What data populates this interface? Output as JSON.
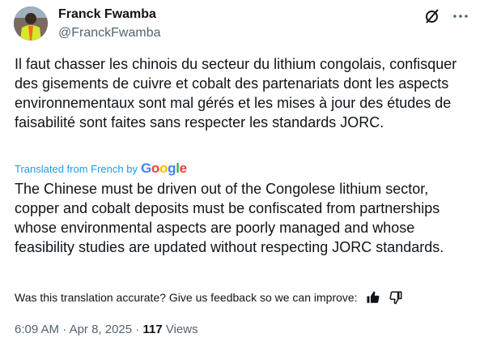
{
  "author": {
    "name": "Franck Fwamba",
    "handle": "@FranckFwamba"
  },
  "tweet": {
    "original_text": "Il faut chasser les chinois du secteur du lithium congolais, confisquer des gisements de cuivre et cobalt des partenariats dont les aspects environnementaux sont mal gérés et les mises à jour des études de faisabilité sont faites sans respecter les standards JORC.",
    "translated_label": "Translated from French by",
    "translator_logo_text": "Google",
    "translated_text": "The Chinese must be driven out of the Congolese lithium sector, copper and cobalt deposits must be confiscated from partnerships whose environmental aspects are poorly managed and whose feasibility studies are updated without respecting JORC standards."
  },
  "feedback": {
    "prompt": "Was this translation accurate? Give us feedback so we can improve:"
  },
  "meta": {
    "time": "6:09 AM",
    "separator": "·",
    "date": "Apr 8, 2025",
    "views_count": "117",
    "views_label": "Views"
  },
  "icons": {
    "grok": "grok-icon",
    "more": "more-icon",
    "thumbs_up": "thumbs-up-icon",
    "thumbs_down": "thumbs-down-icon"
  },
  "colors": {
    "link": "#1d9bf0",
    "secondary_text": "#536471",
    "primary_text": "#0f1419",
    "google_blue": "#4285F4",
    "google_red": "#EA4335",
    "google_yellow": "#FBBC05",
    "google_green": "#34A853"
  }
}
